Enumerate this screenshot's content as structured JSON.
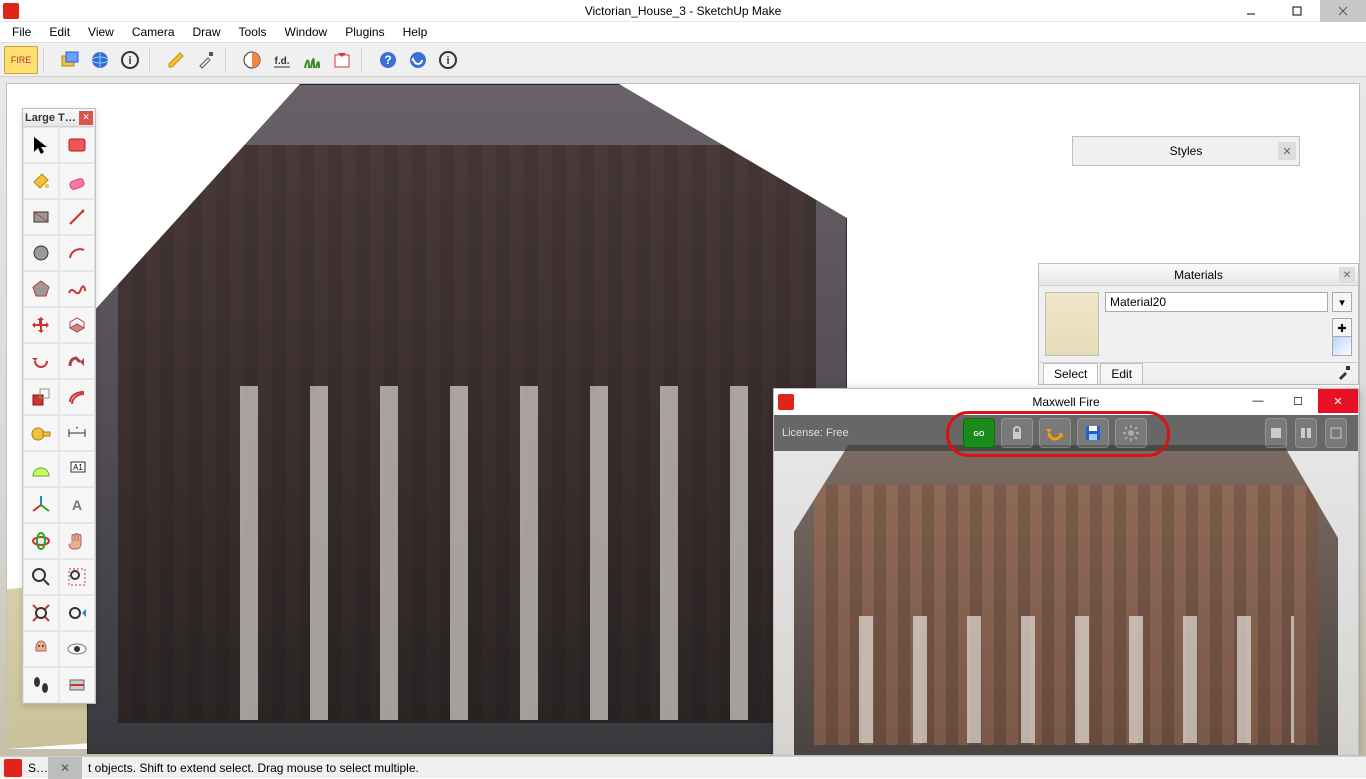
{
  "window": {
    "title": "Victorian_House_3 - SketchUp Make"
  },
  "menu": [
    "File",
    "Edit",
    "View",
    "Camera",
    "Draw",
    "Tools",
    "Window",
    "Plugins",
    "Help"
  ],
  "top_toolbar": {
    "fire_label": "FIRE"
  },
  "large_toolset": {
    "title": "Large T…"
  },
  "styles_panel": {
    "title": "Styles"
  },
  "materials_panel": {
    "title": "Materials",
    "material_name": "Material20",
    "tabs": {
      "select": "Select",
      "edit": "Edit"
    }
  },
  "maxwell": {
    "title": "Maxwell Fire",
    "license_text": "License: Free"
  },
  "status": {
    "prefix": "S…",
    "text": "t objects. Shift to extend select. Drag mouse to select multiple."
  }
}
